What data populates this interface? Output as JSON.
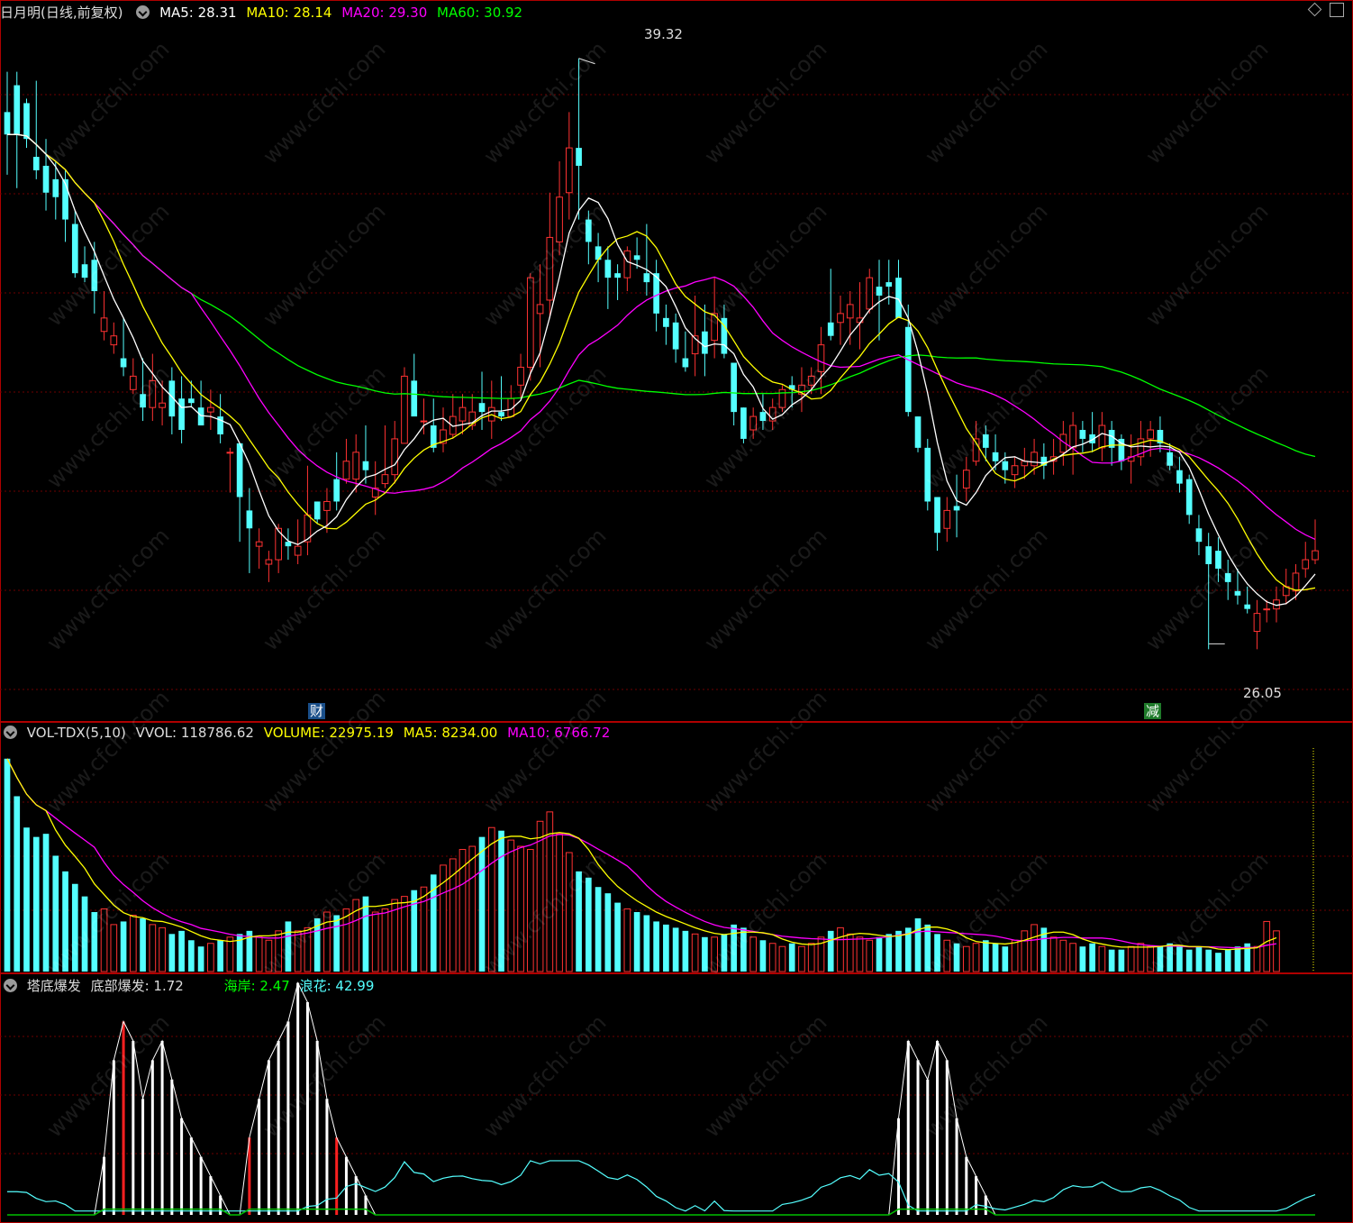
{
  "main": {
    "stock_name": "日月明",
    "period": "(日线,前复权)",
    "ma5": {
      "label": "MA5: 28.31",
      "color": "#ffffff"
    },
    "ma10": {
      "label": "MA10: 28.14",
      "color": "#ffff00"
    },
    "ma20": {
      "label": "MA20: 29.30",
      "color": "#ff00ff"
    },
    "ma60": {
      "label": "MA60: 30.92",
      "color": "#00ff00"
    },
    "high_marker": "39.32",
    "low_marker": "26.05",
    "badge_cai": "财",
    "badge_jian": "减"
  },
  "volume": {
    "indicator": "VOL-TDX(5,10)",
    "vvol": "VVOL: 118786.62",
    "volume": "VOLUME: 22975.19",
    "ma5": "MA5: 8234.00",
    "ma10": "MA10: 6766.72"
  },
  "bottom": {
    "indicator": "塔底爆发",
    "bottom_burst": "底部爆发: 1.72",
    "shore": "海岸: 2.47",
    "wave": "浪花: 42.99"
  },
  "watermark": "www.cfchi.com",
  "colors": {
    "up": "#ff3232",
    "down": "#54ffff",
    "frame": "#b00000",
    "grid": "#6e0000"
  },
  "chart_data": [
    {
      "type": "candlestick",
      "price_ylim": [
        25.0,
        40.0
      ],
      "ma_labels": [
        "MA5",
        "MA10",
        "MA20",
        "MA60"
      ],
      "candles": [
        {
          "o": 38.1,
          "h": 39.0,
          "l": 36.7,
          "c": 37.6
        },
        {
          "o": 38.7,
          "h": 39.0,
          "l": 36.4,
          "c": 37.6
        },
        {
          "o": 38.3,
          "h": 38.4,
          "l": 37.3,
          "c": 37.5
        },
        {
          "o": 37.1,
          "h": 38.8,
          "l": 36.6,
          "c": 36.8
        },
        {
          "o": 36.9,
          "h": 37.5,
          "l": 35.9,
          "c": 36.3
        },
        {
          "o": 36.6,
          "h": 37.0,
          "l": 35.7,
          "c": 36.2
        },
        {
          "o": 36.6,
          "h": 36.8,
          "l": 35.2,
          "c": 35.7
        },
        {
          "o": 35.6,
          "h": 35.9,
          "l": 34.4,
          "c": 34.5
        },
        {
          "o": 34.7,
          "h": 35.1,
          "l": 34.3,
          "c": 34.4
        },
        {
          "o": 34.8,
          "h": 35.2,
          "l": 33.6,
          "c": 34.1
        },
        {
          "o": 33.2,
          "h": 34.1,
          "l": 33.0,
          "c": 33.5
        },
        {
          "o": 32.9,
          "h": 33.4,
          "l": 32.7,
          "c": 33.1
        },
        {
          "o": 32.6,
          "h": 33.5,
          "l": 32.2,
          "c": 32.4
        },
        {
          "o": 31.9,
          "h": 32.6,
          "l": 31.8,
          "c": 32.2
        },
        {
          "o": 31.8,
          "h": 32.6,
          "l": 31.2,
          "c": 31.5
        },
        {
          "o": 31.5,
          "h": 32.7,
          "l": 31.2,
          "c": 32.1
        },
        {
          "o": 31.5,
          "h": 32.1,
          "l": 31.1,
          "c": 31.6
        },
        {
          "o": 32.1,
          "h": 32.4,
          "l": 30.9,
          "c": 31.3
        },
        {
          "o": 31.7,
          "h": 32.2,
          "l": 30.7,
          "c": 31.0
        },
        {
          "o": 31.7,
          "h": 32.1,
          "l": 31.5,
          "c": 31.6
        },
        {
          "o": 31.5,
          "h": 32.1,
          "l": 31.1,
          "c": 31.1
        },
        {
          "o": 31.4,
          "h": 31.9,
          "l": 31.0,
          "c": 31.5
        },
        {
          "o": 31.3,
          "h": 31.8,
          "l": 30.7,
          "c": 30.9
        },
        {
          "o": 30.5,
          "h": 30.6,
          "l": 29.6,
          "c": 30.5
        },
        {
          "o": 30.7,
          "h": 30.7,
          "l": 28.5,
          "c": 29.5
        },
        {
          "o": 29.2,
          "h": 29.7,
          "l": 27.8,
          "c": 28.8
        },
        {
          "o": 28.4,
          "h": 28.8,
          "l": 27.9,
          "c": 28.5
        },
        {
          "o": 28.0,
          "h": 28.3,
          "l": 27.6,
          "c": 28.1
        },
        {
          "o": 28.1,
          "h": 28.9,
          "l": 27.8,
          "c": 28.8
        },
        {
          "o": 28.5,
          "h": 28.8,
          "l": 28.1,
          "c": 28.4
        },
        {
          "o": 28.2,
          "h": 29.0,
          "l": 28.0,
          "c": 28.4
        },
        {
          "o": 28.5,
          "h": 30.2,
          "l": 28.2,
          "c": 29.1
        },
        {
          "o": 29.4,
          "h": 29.4,
          "l": 28.9,
          "c": 29.0
        },
        {
          "o": 29.2,
          "h": 29.7,
          "l": 28.7,
          "c": 29.4
        },
        {
          "o": 29.9,
          "h": 30.5,
          "l": 29.2,
          "c": 29.4
        },
        {
          "o": 29.9,
          "h": 30.8,
          "l": 29.8,
          "c": 30.3
        },
        {
          "o": 29.9,
          "h": 30.9,
          "l": 29.6,
          "c": 30.5
        },
        {
          "o": 30.3,
          "h": 31.1,
          "l": 29.8,
          "c": 30.1
        },
        {
          "o": 29.5,
          "h": 30.3,
          "l": 29.1,
          "c": 29.7
        },
        {
          "o": 29.8,
          "h": 31.1,
          "l": 29.7,
          "c": 30.0
        },
        {
          "o": 30.0,
          "h": 31.2,
          "l": 29.8,
          "c": 30.8
        },
        {
          "o": 30.7,
          "h": 32.4,
          "l": 30.7,
          "c": 32.2
        },
        {
          "o": 32.1,
          "h": 32.7,
          "l": 31.8,
          "c": 31.3
        },
        {
          "o": 31.2,
          "h": 31.7,
          "l": 30.9,
          "c": 31.2
        },
        {
          "o": 31.1,
          "h": 31.7,
          "l": 30.5,
          "c": 30.6
        },
        {
          "o": 30.7,
          "h": 31.5,
          "l": 30.5,
          "c": 31.0
        },
        {
          "o": 30.9,
          "h": 31.8,
          "l": 30.8,
          "c": 31.3
        },
        {
          "o": 31.2,
          "h": 31.8,
          "l": 30.9,
          "c": 31.5
        },
        {
          "o": 31.1,
          "h": 31.8,
          "l": 31.0,
          "c": 31.4
        },
        {
          "o": 31.6,
          "h": 32.3,
          "l": 31.0,
          "c": 31.4
        },
        {
          "o": 31.2,
          "h": 32.1,
          "l": 30.8,
          "c": 31.5
        },
        {
          "o": 31.4,
          "h": 32.2,
          "l": 31.2,
          "c": 31.3
        },
        {
          "o": 31.3,
          "h": 32.0,
          "l": 31.3,
          "c": 31.7
        },
        {
          "o": 32.0,
          "h": 32.7,
          "l": 31.7,
          "c": 32.4
        },
        {
          "o": 32.4,
          "h": 34.5,
          "l": 32.1,
          "c": 34.4
        },
        {
          "o": 33.6,
          "h": 34.7,
          "l": 32.4,
          "c": 33.8
        },
        {
          "o": 33.9,
          "h": 36.3,
          "l": 33.5,
          "c": 35.3
        },
        {
          "o": 35.2,
          "h": 37.0,
          "l": 34.9,
          "c": 36.2
        },
        {
          "o": 36.3,
          "h": 38.1,
          "l": 35.7,
          "c": 37.3
        },
        {
          "o": 37.3,
          "h": 39.3,
          "l": 35.7,
          "c": 36.9
        },
        {
          "o": 35.7,
          "h": 35.9,
          "l": 34.7,
          "c": 35.2
        },
        {
          "o": 35.1,
          "h": 35.4,
          "l": 34.3,
          "c": 34.8
        },
        {
          "o": 34.8,
          "h": 35.1,
          "l": 33.7,
          "c": 34.4
        },
        {
          "o": 34.5,
          "h": 34.7,
          "l": 33.9,
          "c": 34.4
        },
        {
          "o": 34.4,
          "h": 35.1,
          "l": 34.1,
          "c": 35.0
        },
        {
          "o": 34.9,
          "h": 35.3,
          "l": 34.6,
          "c": 34.8
        },
        {
          "o": 34.5,
          "h": 35.6,
          "l": 34.0,
          "c": 34.3
        },
        {
          "o": 34.5,
          "h": 34.8,
          "l": 33.2,
          "c": 33.6
        },
        {
          "o": 33.5,
          "h": 33.8,
          "l": 32.9,
          "c": 33.3
        },
        {
          "o": 33.4,
          "h": 33.6,
          "l": 32.5,
          "c": 32.8
        },
        {
          "o": 32.6,
          "h": 33.2,
          "l": 32.3,
          "c": 32.4
        },
        {
          "o": 32.7,
          "h": 34.0,
          "l": 32.2,
          "c": 33.1
        },
        {
          "o": 33.2,
          "h": 33.8,
          "l": 32.2,
          "c": 32.7
        },
        {
          "o": 33.0,
          "h": 34.4,
          "l": 32.6,
          "c": 33.6
        },
        {
          "o": 33.5,
          "h": 33.8,
          "l": 32.6,
          "c": 32.7
        },
        {
          "o": 32.5,
          "h": 32.5,
          "l": 31.1,
          "c": 31.4
        },
        {
          "o": 31.5,
          "h": 31.5,
          "l": 30.7,
          "c": 30.8
        },
        {
          "o": 31.0,
          "h": 31.5,
          "l": 30.8,
          "c": 31.3
        },
        {
          "o": 31.4,
          "h": 31.8,
          "l": 31.0,
          "c": 31.2
        },
        {
          "o": 31.2,
          "h": 31.7,
          "l": 31.0,
          "c": 31.5
        },
        {
          "o": 31.5,
          "h": 32.0,
          "l": 31.4,
          "c": 31.9
        },
        {
          "o": 32.0,
          "h": 32.2,
          "l": 31.5,
          "c": 31.9
        },
        {
          "o": 31.8,
          "h": 32.4,
          "l": 31.4,
          "c": 32.0
        },
        {
          "o": 32.0,
          "h": 32.4,
          "l": 31.8,
          "c": 32.2
        },
        {
          "o": 32.3,
          "h": 33.3,
          "l": 31.8,
          "c": 32.9
        },
        {
          "o": 33.4,
          "h": 34.6,
          "l": 33.0,
          "c": 33.1
        },
        {
          "o": 33.4,
          "h": 34.0,
          "l": 32.9,
          "c": 33.6
        },
        {
          "o": 33.5,
          "h": 34.1,
          "l": 32.9,
          "c": 33.8
        },
        {
          "o": 33.4,
          "h": 34.3,
          "l": 32.8,
          "c": 33.5
        },
        {
          "o": 33.7,
          "h": 34.6,
          "l": 33.6,
          "c": 34.4
        },
        {
          "o": 34.2,
          "h": 34.8,
          "l": 33.0,
          "c": 34.0
        },
        {
          "o": 34.3,
          "h": 34.8,
          "l": 33.8,
          "c": 34.2
        },
        {
          "o": 34.4,
          "h": 34.8,
          "l": 33.8,
          "c": 33.5
        },
        {
          "o": 33.3,
          "h": 33.8,
          "l": 31.3,
          "c": 31.4
        },
        {
          "o": 31.3,
          "h": 31.3,
          "l": 30.5,
          "c": 30.6
        },
        {
          "o": 30.6,
          "h": 30.8,
          "l": 29.2,
          "c": 29.4
        },
        {
          "o": 29.5,
          "h": 29.5,
          "l": 28.3,
          "c": 28.7
        },
        {
          "o": 28.8,
          "h": 29.5,
          "l": 28.5,
          "c": 29.2
        },
        {
          "o": 29.3,
          "h": 30.0,
          "l": 28.6,
          "c": 29.2
        },
        {
          "o": 29.7,
          "h": 30.4,
          "l": 29.4,
          "c": 30.1
        },
        {
          "o": 30.3,
          "h": 31.2,
          "l": 30.2,
          "c": 30.8
        },
        {
          "o": 30.9,
          "h": 31.1,
          "l": 30.3,
          "c": 30.6
        },
        {
          "o": 30.5,
          "h": 30.9,
          "l": 30.1,
          "c": 30.3
        },
        {
          "o": 30.3,
          "h": 30.5,
          "l": 29.8,
          "c": 30.1
        },
        {
          "o": 30.0,
          "h": 30.4,
          "l": 29.7,
          "c": 30.2
        },
        {
          "o": 30.2,
          "h": 30.6,
          "l": 29.9,
          "c": 30.3
        },
        {
          "o": 30.2,
          "h": 30.8,
          "l": 30.0,
          "c": 30.5
        },
        {
          "o": 30.4,
          "h": 30.7,
          "l": 29.9,
          "c": 30.2
        },
        {
          "o": 30.3,
          "h": 30.8,
          "l": 30.0,
          "c": 30.4
        },
        {
          "o": 30.5,
          "h": 31.2,
          "l": 30.2,
          "c": 30.9
        },
        {
          "o": 30.6,
          "h": 31.4,
          "l": 30.0,
          "c": 31.1
        },
        {
          "o": 31.0,
          "h": 31.2,
          "l": 30.5,
          "c": 30.8
        },
        {
          "o": 30.9,
          "h": 31.4,
          "l": 30.5,
          "c": 30.7
        },
        {
          "o": 30.6,
          "h": 31.4,
          "l": 30.3,
          "c": 31.1
        },
        {
          "o": 31.0,
          "h": 31.2,
          "l": 30.2,
          "c": 30.6
        },
        {
          "o": 30.8,
          "h": 30.9,
          "l": 30.1,
          "c": 30.3
        },
        {
          "o": 30.3,
          "h": 30.9,
          "l": 29.8,
          "c": 30.4
        },
        {
          "o": 30.4,
          "h": 31.2,
          "l": 30.2,
          "c": 30.8
        },
        {
          "o": 30.8,
          "h": 31.2,
          "l": 30.4,
          "c": 31.0
        },
        {
          "o": 31.0,
          "h": 31.3,
          "l": 30.5,
          "c": 30.7
        },
        {
          "o": 30.5,
          "h": 30.7,
          "l": 30.1,
          "c": 30.2
        },
        {
          "o": 30.1,
          "h": 30.4,
          "l": 29.6,
          "c": 29.8
        },
        {
          "o": 29.9,
          "h": 30.0,
          "l": 28.9,
          "c": 29.1
        },
        {
          "o": 28.8,
          "h": 29.1,
          "l": 28.2,
          "c": 28.5
        },
        {
          "o": 28.4,
          "h": 28.7,
          "l": 26.1,
          "c": 28.0
        },
        {
          "o": 28.3,
          "h": 28.6,
          "l": 27.6,
          "c": 27.9
        },
        {
          "o": 27.8,
          "h": 28.1,
          "l": 27.2,
          "c": 27.6
        },
        {
          "o": 27.4,
          "h": 27.9,
          "l": 27.1,
          "c": 27.3
        },
        {
          "o": 27.1,
          "h": 27.5,
          "l": 26.9,
          "c": 27.0
        },
        {
          "o": 26.5,
          "h": 27.2,
          "l": 26.1,
          "c": 26.9
        },
        {
          "o": 27.0,
          "h": 27.2,
          "l": 26.7,
          "c": 27.0
        },
        {
          "o": 27.0,
          "h": 27.5,
          "l": 26.7,
          "c": 27.2
        },
        {
          "o": 27.3,
          "h": 27.9,
          "l": 27.1,
          "c": 27.5
        },
        {
          "o": 27.4,
          "h": 28.0,
          "l": 27.2,
          "c": 27.8
        },
        {
          "o": 27.9,
          "h": 28.5,
          "l": 27.7,
          "c": 28.1
        },
        {
          "o": 28.1,
          "h": 29.0,
          "l": 28.0,
          "c": 28.3
        }
      ],
      "volume": [
        6.8,
        5.6,
        4.6,
        4.3,
        4.4,
        3.7,
        3.2,
        2.8,
        2.4,
        1.9,
        2.0,
        1.5,
        1.6,
        1.8,
        1.7,
        1.5,
        1.4,
        1.2,
        1.3,
        1.0,
        0.8,
        0.9,
        1.0,
        1.1,
        1.2,
        1.3,
        1.1,
        1.0,
        1.3,
        1.6,
        1.3,
        1.4,
        1.7,
        1.9,
        1.8,
        2.0,
        2.3,
        2.4,
        1.9,
        2.0,
        2.3,
        2.4,
        2.6,
        2.7,
        3.1,
        3.4,
        3.6,
        3.9,
        4.0,
        4.3,
        4.6,
        4.5,
        4.2,
        4.0,
        3.9,
        4.8,
        5.1,
        4.4,
        3.8,
        3.2,
        3.0,
        2.7,
        2.5,
        2.2,
        2.0,
        1.9,
        1.8,
        1.6,
        1.5,
        1.4,
        1.3,
        1.2,
        1.1,
        1.1,
        1.2,
        1.5,
        1.4,
        1.1,
        1.0,
        0.9,
        0.8,
        0.9,
        0.8,
        0.9,
        1.1,
        1.3,
        1.4,
        1.2,
        1.1,
        1.0,
        1.1,
        1.2,
        1.3,
        1.4,
        1.7,
        1.5,
        1.2,
        1.0,
        0.9,
        0.8,
        0.9,
        1.0,
        0.9,
        0.8,
        1.0,
        1.3,
        1.5,
        1.4,
        1.1,
        1.0,
        0.9,
        0.8,
        0.9,
        0.8,
        0.7,
        0.7,
        0.8,
        0.9,
        0.8,
        0.8,
        0.9,
        0.8,
        0.7,
        0.8,
        0.7,
        0.6,
        0.7,
        0.8,
        0.9,
        0.8,
        1.6,
        1.3
      ],
      "burst": [
        0,
        0,
        0,
        0,
        0,
        0,
        0,
        0,
        0,
        0,
        3,
        8,
        10,
        9,
        6,
        8,
        9,
        7,
        5,
        4,
        3,
        2,
        1,
        0,
        0,
        4,
        6,
        8,
        9,
        10,
        12,
        11,
        9,
        6,
        4,
        3,
        2,
        1,
        0,
        0,
        0,
        0,
        0,
        0,
        0,
        0,
        0,
        0,
        0,
        0,
        0,
        0,
        0,
        0,
        0,
        0,
        0,
        0,
        0,
        0,
        0,
        0,
        0,
        0,
        0,
        0,
        0,
        0,
        0,
        0,
        0,
        0,
        0,
        0,
        0,
        0,
        0,
        0,
        0,
        0,
        0,
        0,
        0,
        0,
        0,
        0,
        0,
        0,
        0,
        0,
        0,
        0,
        5,
        9,
        8,
        7,
        9,
        8,
        5,
        3,
        2,
        1,
        0,
        0,
        0,
        0,
        0,
        0,
        0,
        0,
        0,
        0,
        0,
        0,
        0,
        0,
        0,
        0,
        0,
        0,
        0,
        0,
        0,
        0,
        0,
        0,
        0,
        0,
        0,
        0,
        0,
        0,
        0,
        0,
        0,
        0
      ],
      "burst_red_index": [
        12,
        25,
        34
      ],
      "bottom_ylim": [
        0,
        11
      ],
      "shore_label": "海岸",
      "wave_label": "浪花"
    }
  ]
}
